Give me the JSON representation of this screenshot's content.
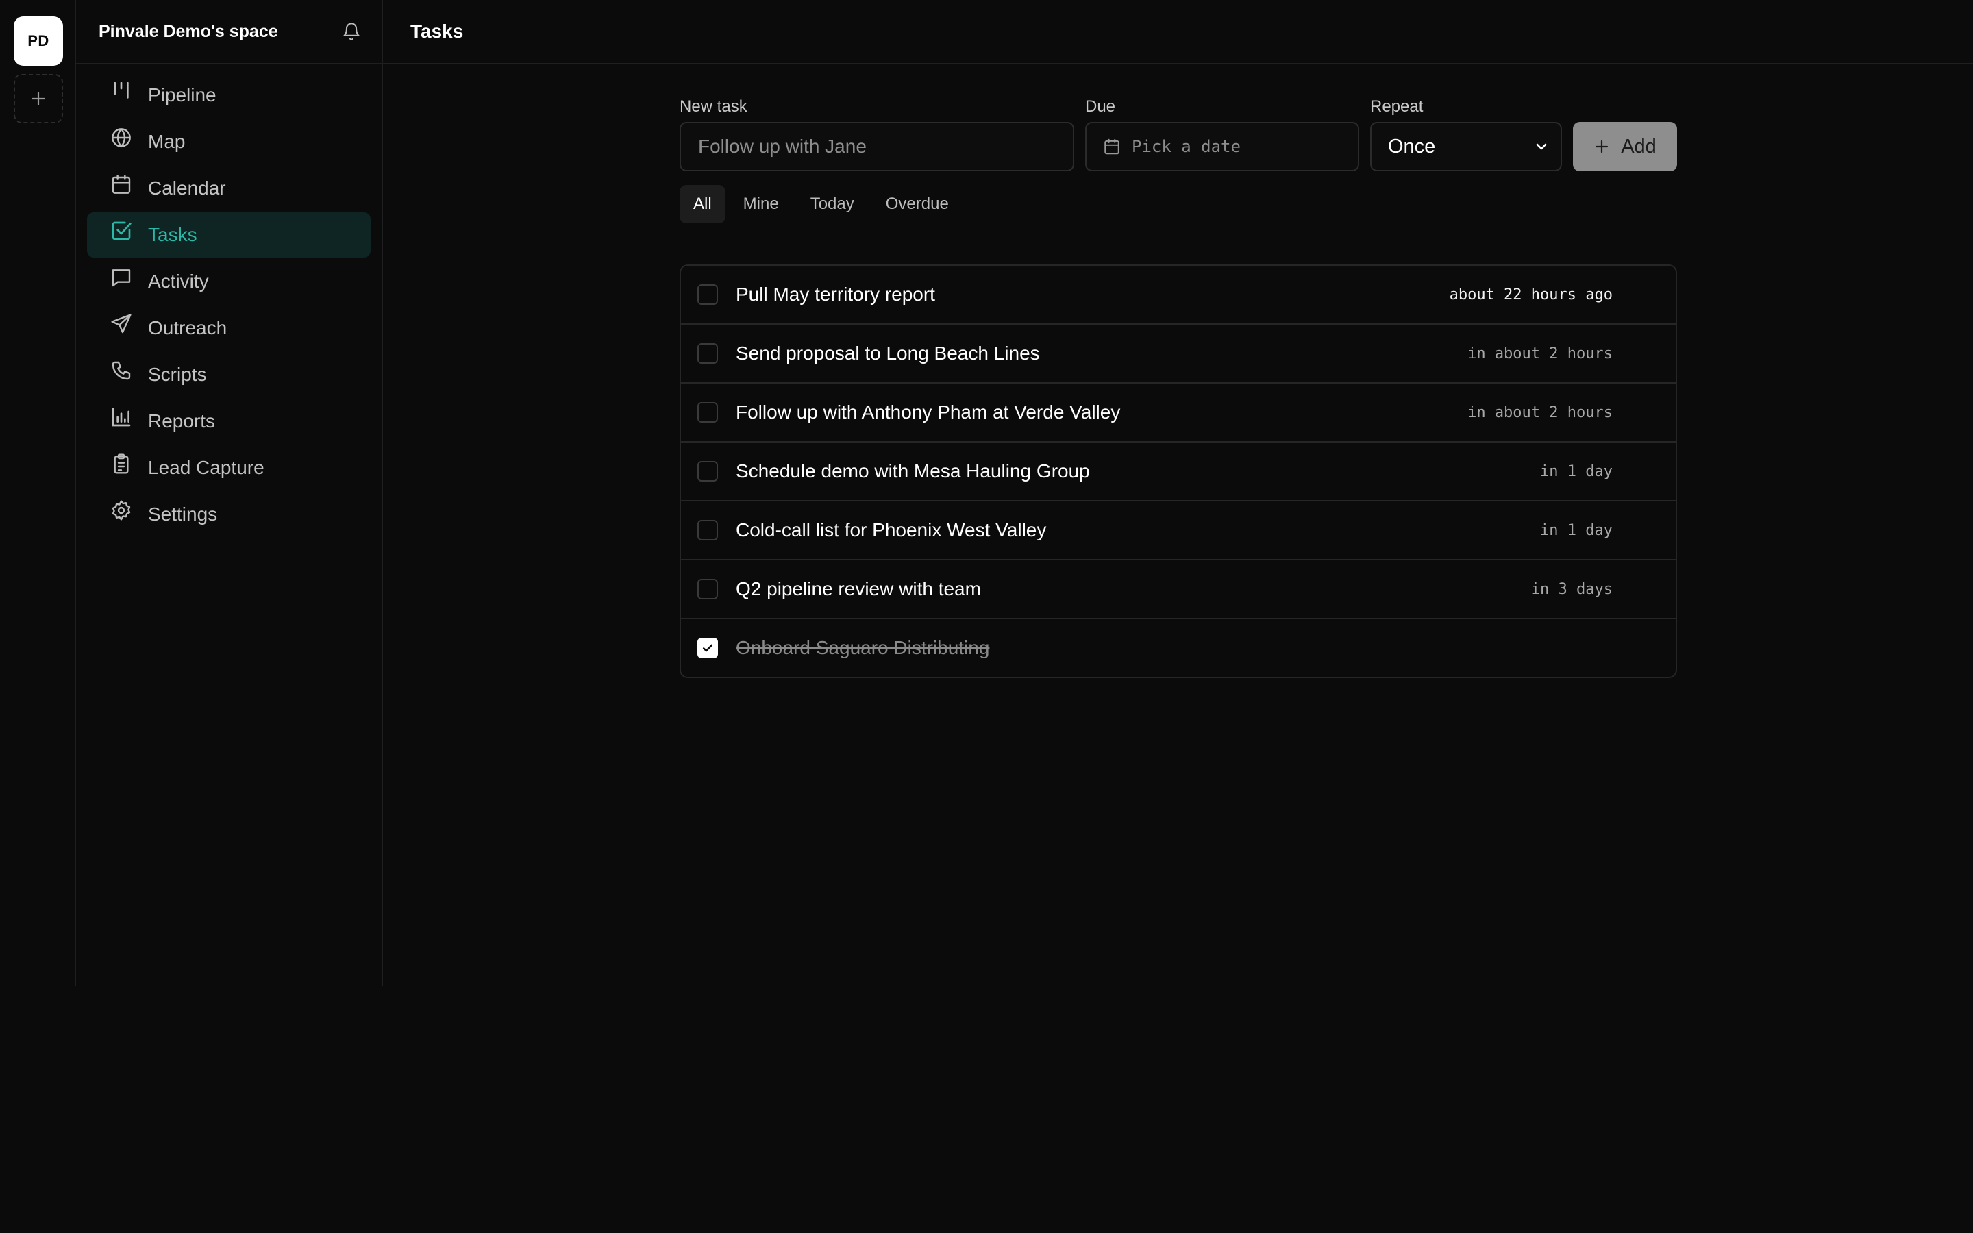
{
  "workspace": {
    "initials": "PD",
    "name": "Pinvale Demo's space"
  },
  "nav": {
    "items": [
      {
        "label": "Pipeline",
        "icon": "pipeline-icon"
      },
      {
        "label": "Map",
        "icon": "globe-icon"
      },
      {
        "label": "Calendar",
        "icon": "calendar-icon"
      },
      {
        "label": "Tasks",
        "icon": "checkbox-icon",
        "active": true
      },
      {
        "label": "Activity",
        "icon": "message-icon"
      },
      {
        "label": "Outreach",
        "icon": "send-icon"
      },
      {
        "label": "Scripts",
        "icon": "phone-icon"
      },
      {
        "label": "Reports",
        "icon": "bar-chart-icon"
      },
      {
        "label": "Lead Capture",
        "icon": "clipboard-icon"
      },
      {
        "label": "Settings",
        "icon": "gear-icon"
      }
    ]
  },
  "header": {
    "title": "Tasks"
  },
  "form": {
    "new_task_label": "New task",
    "new_task_placeholder": "Follow up with Jane",
    "new_task_value": "",
    "due_label": "Due",
    "due_placeholder": "Pick a date",
    "repeat_label": "Repeat",
    "repeat_value": "Once",
    "add_label": "Add"
  },
  "filters": {
    "all": "All",
    "mine": "Mine",
    "today": "Today",
    "overdue": "Overdue",
    "active": "All"
  },
  "tasks": [
    {
      "title": "Pull May territory report",
      "due": "about 22 hours ago",
      "done": false
    },
    {
      "title": "Send proposal to Long Beach Lines",
      "due": "in about 2 hours",
      "done": false
    },
    {
      "title": "Follow up with Anthony Pham at Verde Valley",
      "due": "in about 2 hours",
      "done": false
    },
    {
      "title": "Schedule demo with Mesa Hauling Group",
      "due": "in 1 day",
      "done": false
    },
    {
      "title": "Cold-call list for Phoenix West Valley",
      "due": "in 1 day",
      "done": false
    },
    {
      "title": "Q2 pipeline review with team",
      "due": "in 3 days",
      "done": false
    },
    {
      "title": "Onboard Saguaro Distributing",
      "due": "",
      "done": true
    }
  ],
  "colors": {
    "background": "#0b0b0b",
    "accent": "#2bb8a7",
    "active_nav_bg": "#0f2523",
    "border": "#262626",
    "add_button": "#8e8e8e"
  }
}
